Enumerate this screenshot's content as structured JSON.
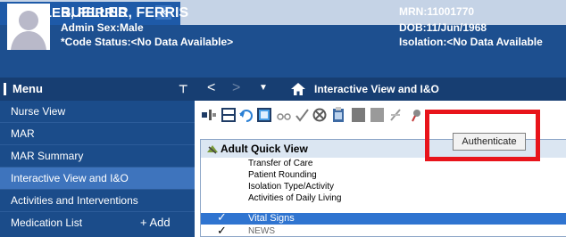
{
  "patient_tab": {
    "name": "BUELLER, FERRIS",
    "close_glyph": "×"
  },
  "banner": {
    "name": "BUELLER, FERRIS",
    "admin_sex": "Admin Sex:Male",
    "code_status": "*Code Status:<No Data Available>",
    "mrn": "MRN:11001770",
    "dob": "DOB:11/Jun/1968",
    "isolation": "Isolation:<No Data Available"
  },
  "menu": {
    "title": "Menu",
    "pin_glyph": "⊤",
    "items": [
      {
        "label": "Nurse View"
      },
      {
        "label": "MAR"
      },
      {
        "label": "MAR Summary"
      },
      {
        "label": "Interactive View and I&O",
        "selected": true
      },
      {
        "label": "Activities and Interventions"
      },
      {
        "label": "Medication List",
        "action": "+ Add"
      }
    ]
  },
  "view_header": {
    "back_glyph": "<",
    "forward_glyph": ">",
    "dropdown_glyph": "▼",
    "title": "Interactive View and I&O"
  },
  "toolbar": {
    "icons": [
      "insert-icon",
      "document-icon",
      "undo-icon",
      "chart-icon",
      "glasses-icon",
      "sign-check-icon",
      "cancel-icon",
      "clipboard-icon",
      "gray-square-icon",
      "gray-square-2-icon",
      "crossed-icon",
      "authenticate-icon"
    ]
  },
  "tooltip": {
    "text": "Authenticate"
  },
  "band": {
    "title": "Adult Quick View",
    "rows": [
      {
        "label": "Transfer of Care"
      },
      {
        "label": "Patient Rounding"
      },
      {
        "label": "Isolation Type/Activity"
      },
      {
        "label": "Activities of Daily Living"
      },
      {
        "label": "Vital Signs",
        "selected": true,
        "check": "✓"
      },
      {
        "label": "NEWS",
        "check": "✓"
      }
    ]
  },
  "colors": {
    "banner_bg": "#1d4f8f",
    "menu_bg": "#1b4c8a",
    "menu_selected": "#3e74bd",
    "row_selected": "#2f74d0",
    "highlight": "#e8141b"
  }
}
